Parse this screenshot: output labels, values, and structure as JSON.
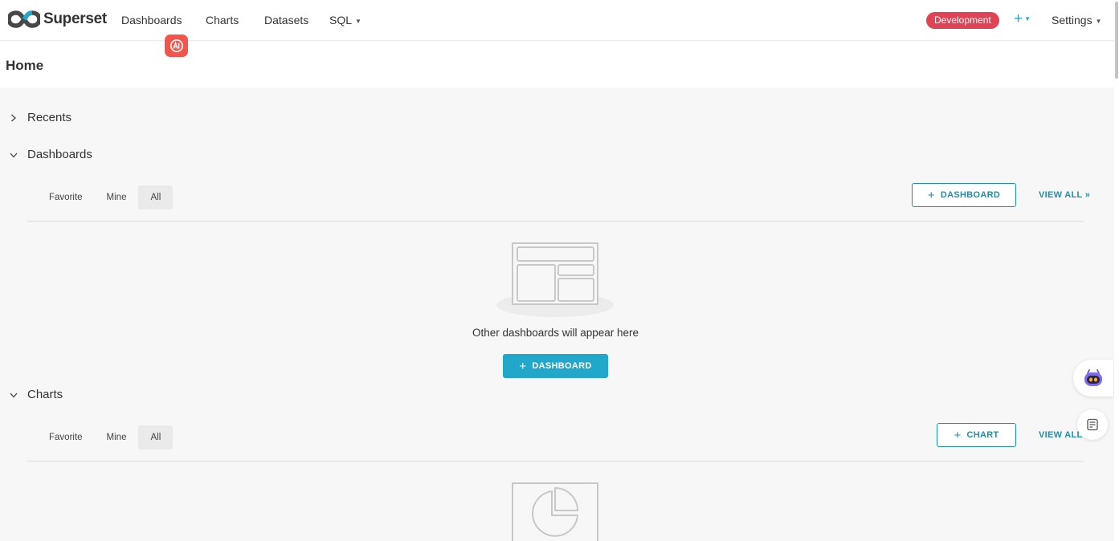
{
  "app": {
    "name": "Superset"
  },
  "nav": {
    "items": [
      "Dashboards",
      "Charts",
      "Datasets",
      "SQL"
    ],
    "env_badge": "Development",
    "plus": "+",
    "settings": "Settings"
  },
  "header": {
    "title": "Home"
  },
  "sections": {
    "recents": {
      "label": "Recents"
    },
    "dashboards": {
      "label": "Dashboards",
      "tabs": [
        "Favorite",
        "Mine",
        "All"
      ],
      "active_tab": "All",
      "add_label": "DASHBOARD",
      "view_all": "VIEW ALL »",
      "empty_text": "Other dashboards will appear here",
      "empty_button": "DASHBOARD"
    },
    "charts": {
      "label": "Charts",
      "tabs": [
        "Favorite",
        "Mine",
        "All"
      ],
      "active_tab": "All",
      "add_label": "CHART",
      "view_all": "VIEW ALL"
    }
  },
  "icons": {
    "ai": "ai-assistant-icon",
    "bot": "chatbot-icon",
    "notes": "notes-icon"
  },
  "colors": {
    "primary": "#20a7c9",
    "primary_dark": "#1e8dae",
    "badge": "#e04355",
    "ai_badge": "#f2554b"
  }
}
